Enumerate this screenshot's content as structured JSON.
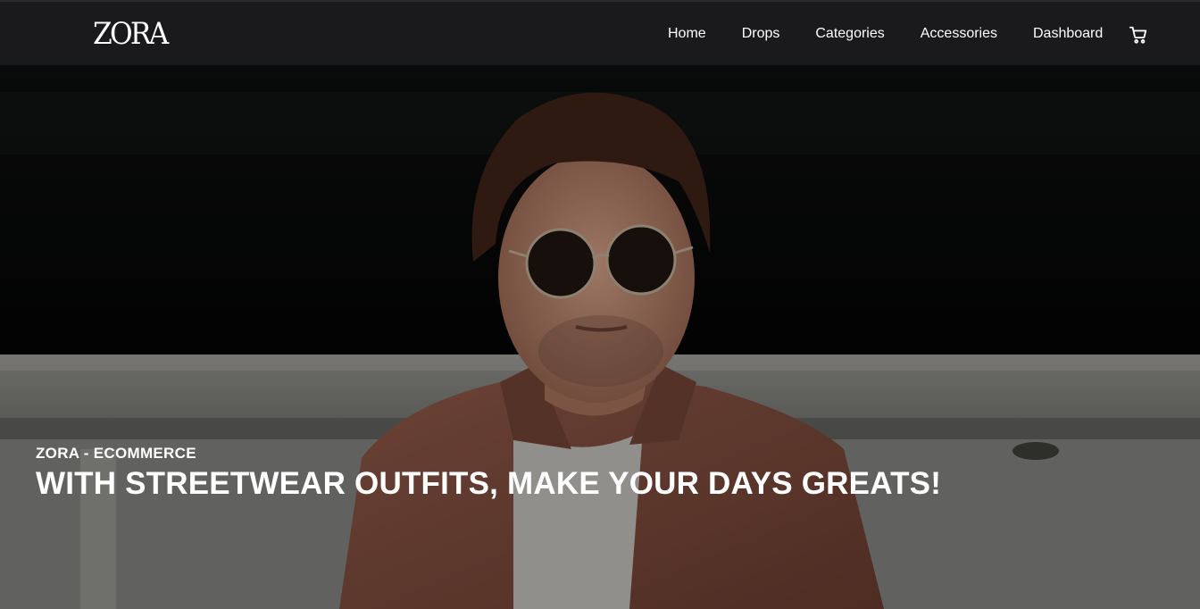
{
  "brand": {
    "logo_text": "ZORA"
  },
  "nav": {
    "items": [
      {
        "label": "Home"
      },
      {
        "label": "Drops"
      },
      {
        "label": "Categories"
      },
      {
        "label": "Accessories"
      },
      {
        "label": "Dashboard"
      }
    ],
    "cart_icon": "cart-icon"
  },
  "hero": {
    "image": "hero-model-photo",
    "eyebrow": "ZORA - ECOMMERCE",
    "headline": "WITH STREETWEAR OUTFITS, MAKE YOUR DAYS GREATS!"
  },
  "colors": {
    "topbar_bg": "#1a1a1c",
    "text": "#ffffff",
    "shirt": "#7a4b3e"
  }
}
